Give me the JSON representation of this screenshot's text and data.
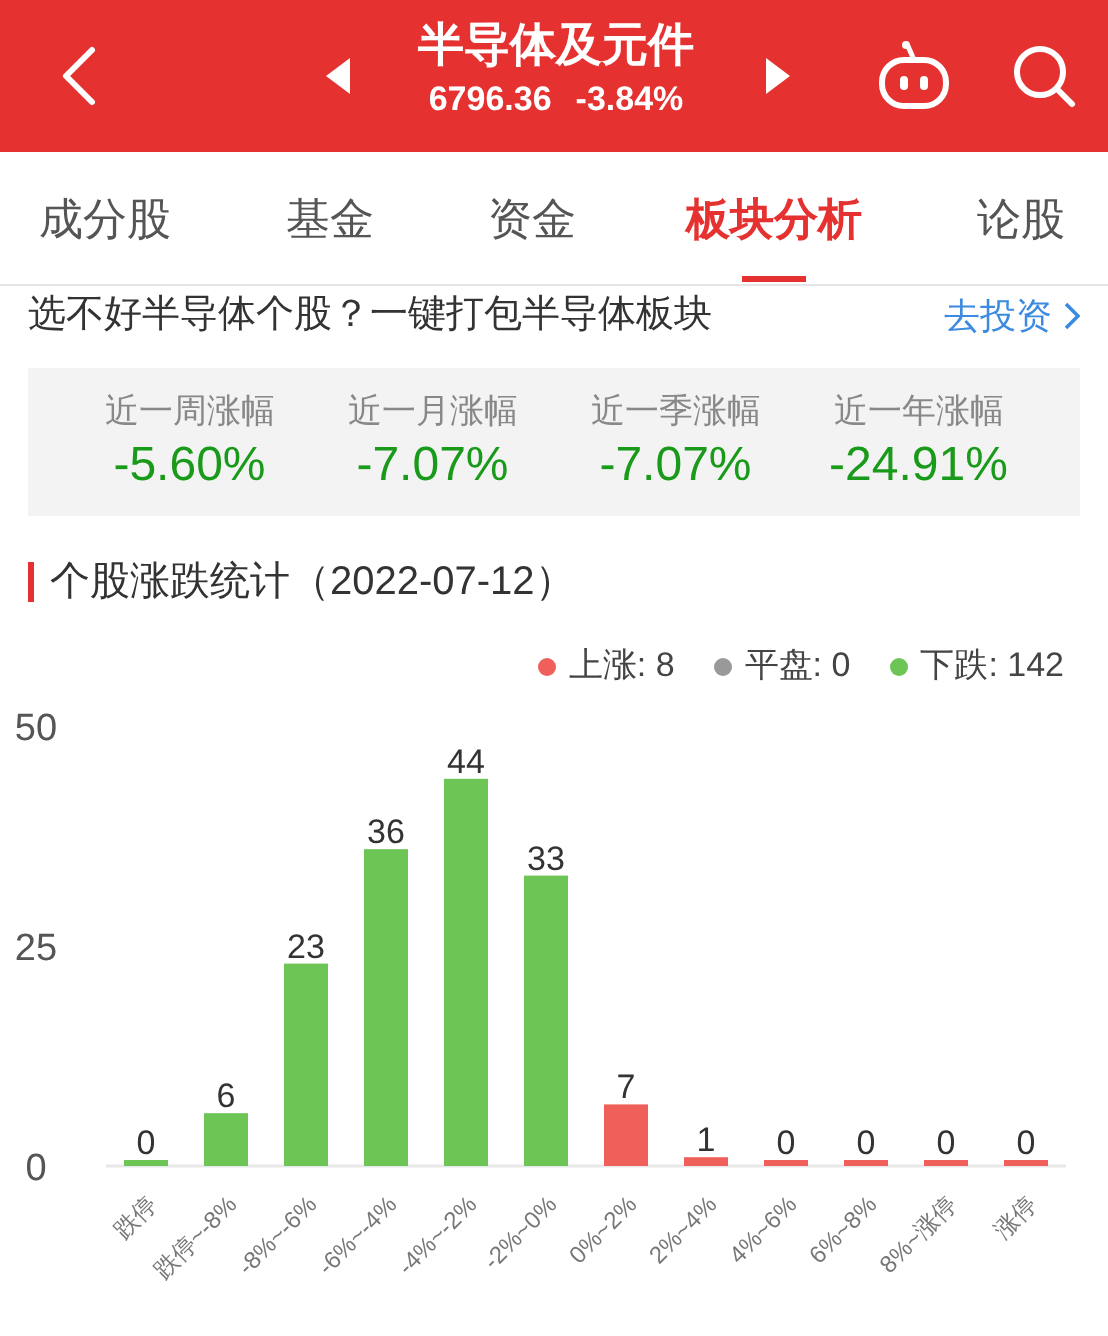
{
  "header": {
    "title": "半导体及元件",
    "price": "6796.36",
    "change": "-3.84%"
  },
  "tabs": [
    {
      "label": "成分股",
      "selected": false
    },
    {
      "label": "基金",
      "selected": false
    },
    {
      "label": "资金",
      "selected": false
    },
    {
      "label": "板块分析",
      "selected": true
    },
    {
      "label": "论股",
      "selected": false
    }
  ],
  "promo": {
    "text": "选不好半导体个股？一键打包半导体板块",
    "link": "去投资"
  },
  "stats": [
    {
      "label": "近一周涨幅",
      "value": "-5.60%"
    },
    {
      "label": "近一月涨幅",
      "value": "-7.07%"
    },
    {
      "label": "近一季涨幅",
      "value": "-7.07%"
    },
    {
      "label": "近一年涨幅",
      "value": "-24.91%"
    }
  ],
  "section_title": "个股涨跌统计（2022-07-12）",
  "legend": [
    {
      "label": "上涨: 8",
      "color": "#f0605a"
    },
    {
      "label": "平盘: 0",
      "color": "#999999"
    },
    {
      "label": "下跌: 142",
      "color": "#6cc554"
    }
  ],
  "chart_data": {
    "type": "bar",
    "data_labels": true,
    "categories": [
      "跌停",
      "跌停~-8%",
      "-8%~-6%",
      "-6%~-4%",
      "-4%~-2%",
      "-2%~0%",
      "0%~2%",
      "2%~4%",
      "4%~6%",
      "6%~8%",
      "8%~涨停",
      "涨停"
    ],
    "series": [
      {
        "color": "#6cc554",
        "values": [
          0,
          6,
          23,
          36,
          44,
          33,
          null,
          null,
          null,
          null,
          null,
          null
        ]
      },
      {
        "color": "#f0605a",
        "values": [
          null,
          null,
          null,
          null,
          null,
          null,
          7,
          1,
          0,
          0,
          0,
          0
        ]
      }
    ],
    "ylim": [
      0,
      50
    ],
    "yticks": [
      0,
      25,
      50
    ]
  }
}
